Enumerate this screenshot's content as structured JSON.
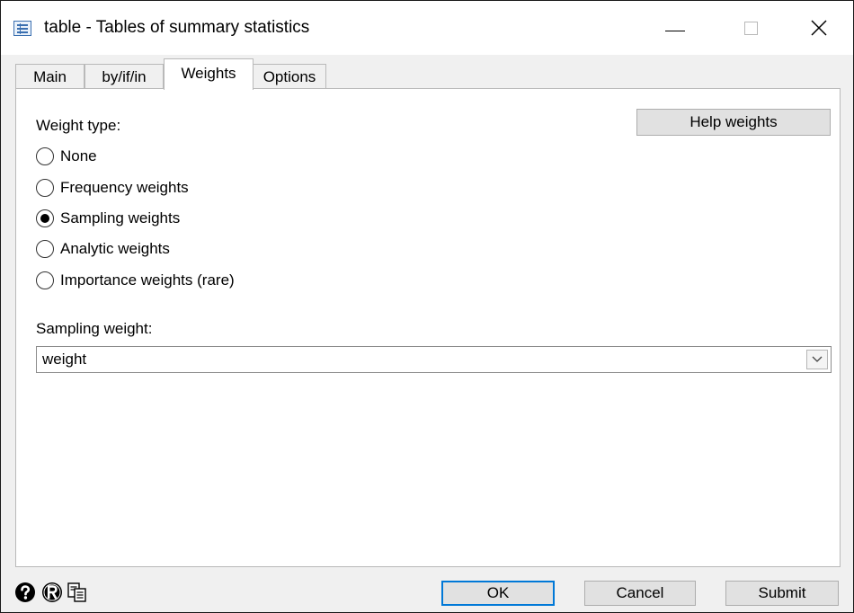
{
  "window": {
    "title": "table - Tables of summary statistics"
  },
  "tabs": [
    {
      "label": "Main"
    },
    {
      "label": "by/if/in"
    },
    {
      "label": "Weights"
    },
    {
      "label": "Options"
    }
  ],
  "weights": {
    "weight_type_label": "Weight type:",
    "help_button": "Help weights",
    "options": [
      {
        "label": "None",
        "selected": false
      },
      {
        "label": "Frequency weights",
        "selected": false
      },
      {
        "label": "Sampling weights",
        "selected": true
      },
      {
        "label": "Analytic weights",
        "selected": false
      },
      {
        "label": "Importance weights (rare)",
        "selected": false
      }
    ],
    "sampling_weight_label": "Sampling weight:",
    "sampling_weight_value": "weight"
  },
  "footer": {
    "icons": [
      "help-icon",
      "reset-icon",
      "copy-icon"
    ],
    "ok": "OK",
    "cancel": "Cancel",
    "submit": "Submit"
  }
}
